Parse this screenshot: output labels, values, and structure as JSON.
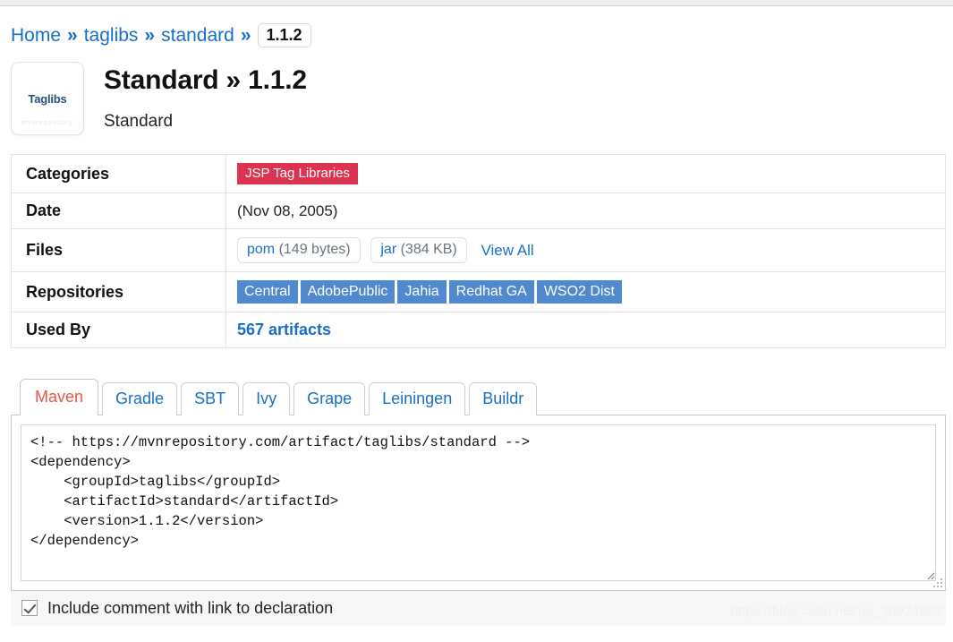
{
  "breadcrumb": {
    "items": [
      {
        "label": "Home"
      },
      {
        "label": "taglibs"
      },
      {
        "label": "standard"
      }
    ],
    "separator": "»",
    "current_version": "1.1.2"
  },
  "header": {
    "logo_text": "Taglibs",
    "logo_watermark": "mvnrepository",
    "title": "Standard » 1.1.2",
    "subtitle": "Standard"
  },
  "info": {
    "rows": [
      {
        "label": "Categories",
        "type": "category"
      },
      {
        "label": "Date",
        "type": "date"
      },
      {
        "label": "Files",
        "type": "files"
      },
      {
        "label": "Repositories",
        "type": "repositories"
      },
      {
        "label": "Used By",
        "type": "usedby"
      }
    ],
    "category_badge": "JSP Tag Libraries",
    "date": "(Nov 08, 2005)",
    "files": [
      {
        "name": "pom",
        "size": "(149 bytes)"
      },
      {
        "name": "jar",
        "size": "(384 KB)"
      }
    ],
    "view_all": "View All",
    "repositories": [
      "Central",
      "AdobePublic",
      "Jahia",
      "Redhat GA",
      "WSO2 Dist"
    ],
    "used_by": "567 artifacts"
  },
  "tabs": [
    {
      "label": "Maven",
      "active": true
    },
    {
      "label": "Gradle",
      "active": false
    },
    {
      "label": "SBT",
      "active": false
    },
    {
      "label": "Ivy",
      "active": false
    },
    {
      "label": "Grape",
      "active": false
    },
    {
      "label": "Leiningen",
      "active": false
    },
    {
      "label": "Buildr",
      "active": false
    }
  ],
  "code": {
    "content": "<!-- https://mvnrepository.com/artifact/taglibs/standard -->\n<dependency>\n    <groupId>taglibs</groupId>\n    <artifactId>standard</artifactId>\n    <version>1.1.2</version>\n</dependency>"
  },
  "footer": {
    "checkbox_label": "Include comment with link to declaration",
    "checked": true
  },
  "watermark": "https://blog.csdn.net/qq_36924683",
  "colors": {
    "link": "#1a6fc4",
    "category_badge": "#dc3350",
    "repo_badge": "#5089ce",
    "active_tab": "#e8564a",
    "logo": "#2a4f7c"
  }
}
